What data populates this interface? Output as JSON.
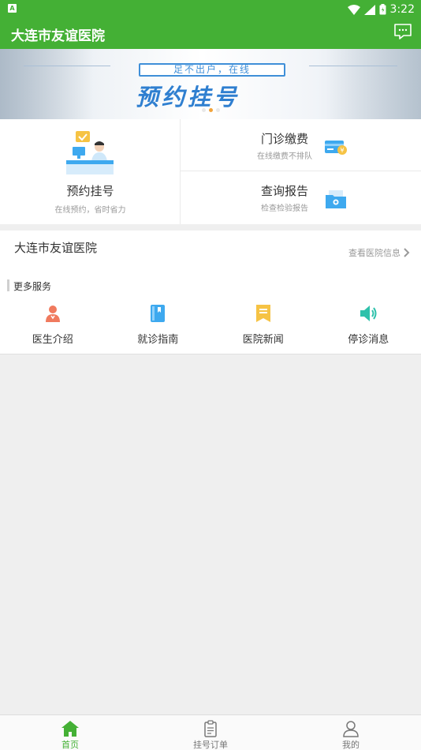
{
  "status_bar": {
    "time": "3:22",
    "notification_icon": "a-app-icon"
  },
  "header": {
    "title": "大连市友谊医院",
    "message_icon": "message-bubble-icon"
  },
  "banner": {
    "ribbon_text": "足不出户，在线",
    "main_text": "预约挂号",
    "dots": 3,
    "active_dot": 2
  },
  "grid": {
    "appointment": {
      "title": "预约挂号",
      "subtitle": "在线预约，省时省力"
    },
    "payment": {
      "title": "门诊缴费",
      "subtitle": "在线缴费不排队"
    },
    "report": {
      "title": "查询报告",
      "subtitle": "检查检验报告"
    }
  },
  "hospital": {
    "name": "大连市友谊医院",
    "link": "查看医院信息",
    "more_services": "更多服务"
  },
  "services": [
    {
      "label": "医生介绍",
      "icon": "doctor-icon",
      "color": "#f07a5e"
    },
    {
      "label": "就诊指南",
      "icon": "book-icon",
      "color": "#3ea9ef"
    },
    {
      "label": "医院新闻",
      "icon": "bookmark-icon",
      "color": "#f6c344"
    },
    {
      "label": "停诊消息",
      "icon": "speaker-icon",
      "color": "#2ec1ab"
    }
  ],
  "bottom_nav": [
    {
      "label": "首页",
      "icon": "home-icon",
      "active": true
    },
    {
      "label": "挂号订单",
      "icon": "clipboard-icon",
      "active": false
    },
    {
      "label": "我的",
      "icon": "user-icon",
      "active": false
    }
  ],
  "colors": {
    "brand_green": "#44b035",
    "banner_blue": "#2f7fd0"
  }
}
